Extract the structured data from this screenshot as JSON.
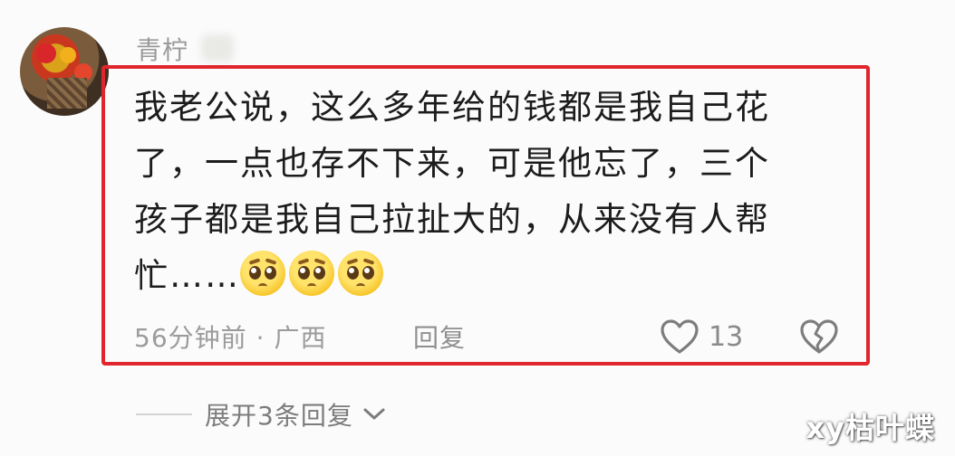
{
  "comment": {
    "username": "青柠",
    "lines": [
      "我老公说，这么多年给的钱都是我自己花",
      "了，一点也存不下来，可是他忘了，三个",
      "孩子都是我自己拉扯大的，从来没有人帮",
      "忙……"
    ],
    "emoji_count": 3,
    "emoji_icon": "pleading-face-emoji",
    "time": "56分钟前",
    "separator": "·",
    "location": "广西",
    "reply_label": "回复",
    "likes": "13",
    "expand_label": "展开3条回复"
  },
  "highlight_color": "#e0262c",
  "watermark": "xy枯叶蝶"
}
